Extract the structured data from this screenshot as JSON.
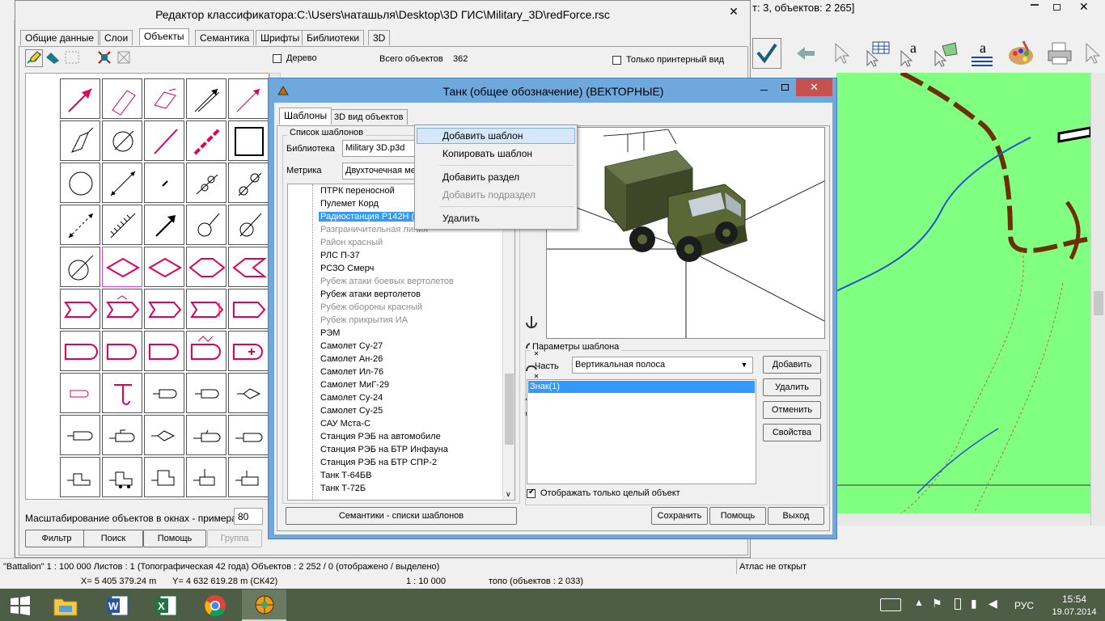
{
  "main_window": {
    "title_fragment": "т: 3, объектов: 2 265]"
  },
  "classifier": {
    "title": "Редактор классификатора:C:\\Users\\наташьля\\Desktop\\3D ГИС\\Military_3D\\redForce.rsc",
    "tabs": [
      "Общие данные",
      "Слои",
      "Объекты",
      "Семантика",
      "Шрифты",
      "Библиотеки",
      "3D"
    ],
    "selected_tab": "Объекты",
    "tree_checkbox": "Дерево",
    "total_label": "Всего объектов",
    "total_value": "362",
    "printer_only": "Только принтерный вид",
    "scale_label": "Масштабирование объектов в окнах - примерах",
    "scale_value": "80",
    "buttons": {
      "filter": "Фильтр",
      "search": "Поиск",
      "help": "Помощь",
      "group": "Группа"
    }
  },
  "dialog": {
    "title": "Танк (общее обозначение) (ВЕКТОРНЫЕ)",
    "tabs": [
      "Шаблоны",
      "3D вид объектов"
    ],
    "templates_group": "Список шаблонов",
    "library_label": "Библиотека",
    "library_value": "Military 3D.p3d",
    "metric_label": "Метрика",
    "metric_value": "Двухточечная ме",
    "tree_items": [
      {
        "text": "ПТРК переносной",
        "grey": false
      },
      {
        "text": "Пулемет Корд",
        "grey": false
      },
      {
        "text": "Радиостанция Р142Н (",
        "grey": false,
        "selected": true
      },
      {
        "text": "Разграничительная линия",
        "grey": true
      },
      {
        "text": "Район красный",
        "grey": true
      },
      {
        "text": "РЛС П-37",
        "grey": false
      },
      {
        "text": "РСЗО Смерч",
        "grey": false
      },
      {
        "text": "Рубеж атаки боевых вертолетов",
        "grey": true
      },
      {
        "text": "Рубеж атаки вертолетов",
        "grey": false
      },
      {
        "text": "Рубеж обороны красный",
        "grey": true
      },
      {
        "text": "Рубеж прикрытия ИА",
        "grey": true
      },
      {
        "text": "РЭМ",
        "grey": false
      },
      {
        "text": "Самолет Су-27",
        "grey": false
      },
      {
        "text": "Самолет Ан-26",
        "grey": false
      },
      {
        "text": "Самолет Ил-76",
        "grey": false
      },
      {
        "text": "Самолет МиГ-29",
        "grey": false
      },
      {
        "text": "Самолет Су-24",
        "grey": false
      },
      {
        "text": "Самолет Су-25",
        "grey": false
      },
      {
        "text": "САУ Мста-С",
        "grey": false
      },
      {
        "text": "Станция РЭБ на автомобиле",
        "grey": false
      },
      {
        "text": "Станция РЭБ на БТР Инфауна",
        "grey": false
      },
      {
        "text": "Станция РЭБ на БТР СПР-2",
        "grey": false
      },
      {
        "text": "Танк Т-64БВ",
        "grey": false
      },
      {
        "text": "Танк Т-72Б",
        "grey": false
      }
    ],
    "semantics_button": "Семантики - списки шаблонов",
    "params_group": "Параметры шаблона",
    "part_label": "Часть",
    "part_value": "Вертикальная полоса",
    "list_item": "Знак(1)",
    "side_buttons": {
      "add": "Добавить",
      "delete": "Удалить",
      "cancel": "Отменить",
      "props": "Свойства"
    },
    "whole_object": "Отображать только целый объект",
    "bottom_buttons": {
      "save": "Сохранить",
      "help": "Помощь",
      "exit": "Выход"
    }
  },
  "context_menu": {
    "items": [
      "Добавить шаблон",
      "Копировать шаблон",
      "Добавить раздел",
      "Добавить подраздел",
      "Удалить"
    ],
    "disabled": [
      "Добавить подраздел"
    ]
  },
  "statusbar": {
    "line1": "\"Battalion\"  1 : 100 000   Листов : 1   (Топографическая 42 года)  Объектов : 2 252 / 0 (отображено / выделено)",
    "atlas": "Атлас не открыт",
    "coords_x": "X= 5 405 379.24 m",
    "coords_y": "Y= 4 632 619.28 m  (СК42)",
    "scale": "1 : 10 000",
    "layer": "топо   (объектов : 2 033)"
  },
  "taskbar": {
    "lang": "РУС",
    "time": "15:54",
    "date": "19.07.2014"
  },
  "colors": {
    "map_green": "#80ff80",
    "accent_blue": "#3399ff",
    "symbol_red": "#e0005a"
  }
}
